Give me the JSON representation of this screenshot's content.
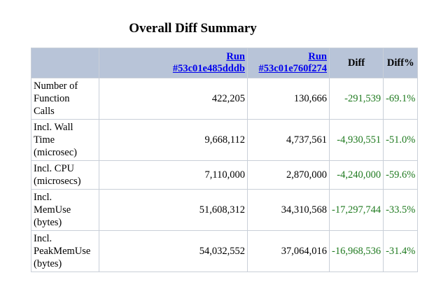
{
  "title": "Overall Diff Summary",
  "header": {
    "run1": {
      "label": "Run",
      "id": "#53c01e485dddb"
    },
    "run2": {
      "label": "Run",
      "id": "#53c01e760f274"
    },
    "diff": "Diff",
    "diff_pct": "Diff%"
  },
  "rows": [
    {
      "label": [
        "Number of",
        "Function",
        "Calls"
      ],
      "run1": "422,205",
      "run2": "130,666",
      "diff": "-291,539",
      "diff_pct": "-69.1%"
    },
    {
      "label": [
        "Incl. Wall",
        "Time",
        "(microsec)"
      ],
      "run1": "9,668,112",
      "run2": "4,737,561",
      "diff": "-4,930,551",
      "diff_pct": "-51.0%"
    },
    {
      "label": [
        "Incl. CPU",
        "(microsecs)"
      ],
      "run1": "7,110,000",
      "run2": "2,870,000",
      "diff": "-4,240,000",
      "diff_pct": "-59.6%"
    },
    {
      "label": [
        "Incl.",
        "MemUse",
        "(bytes)"
      ],
      "run1": "51,608,312",
      "run2": "34,310,568",
      "diff": "-17,297,744",
      "diff_pct": "-33.5%"
    },
    {
      "label": [
        "Incl.",
        "PeakMemUse",
        "(bytes)"
      ],
      "run1": "54,032,552",
      "run2": "37,064,016",
      "diff": "-16,968,536",
      "diff_pct": "-31.4%"
    }
  ],
  "colors": {
    "header_bg": "#b8c4d8",
    "border": "#c9cfd8",
    "link": "#0000ee",
    "diff_text": "#1f7a1f"
  }
}
